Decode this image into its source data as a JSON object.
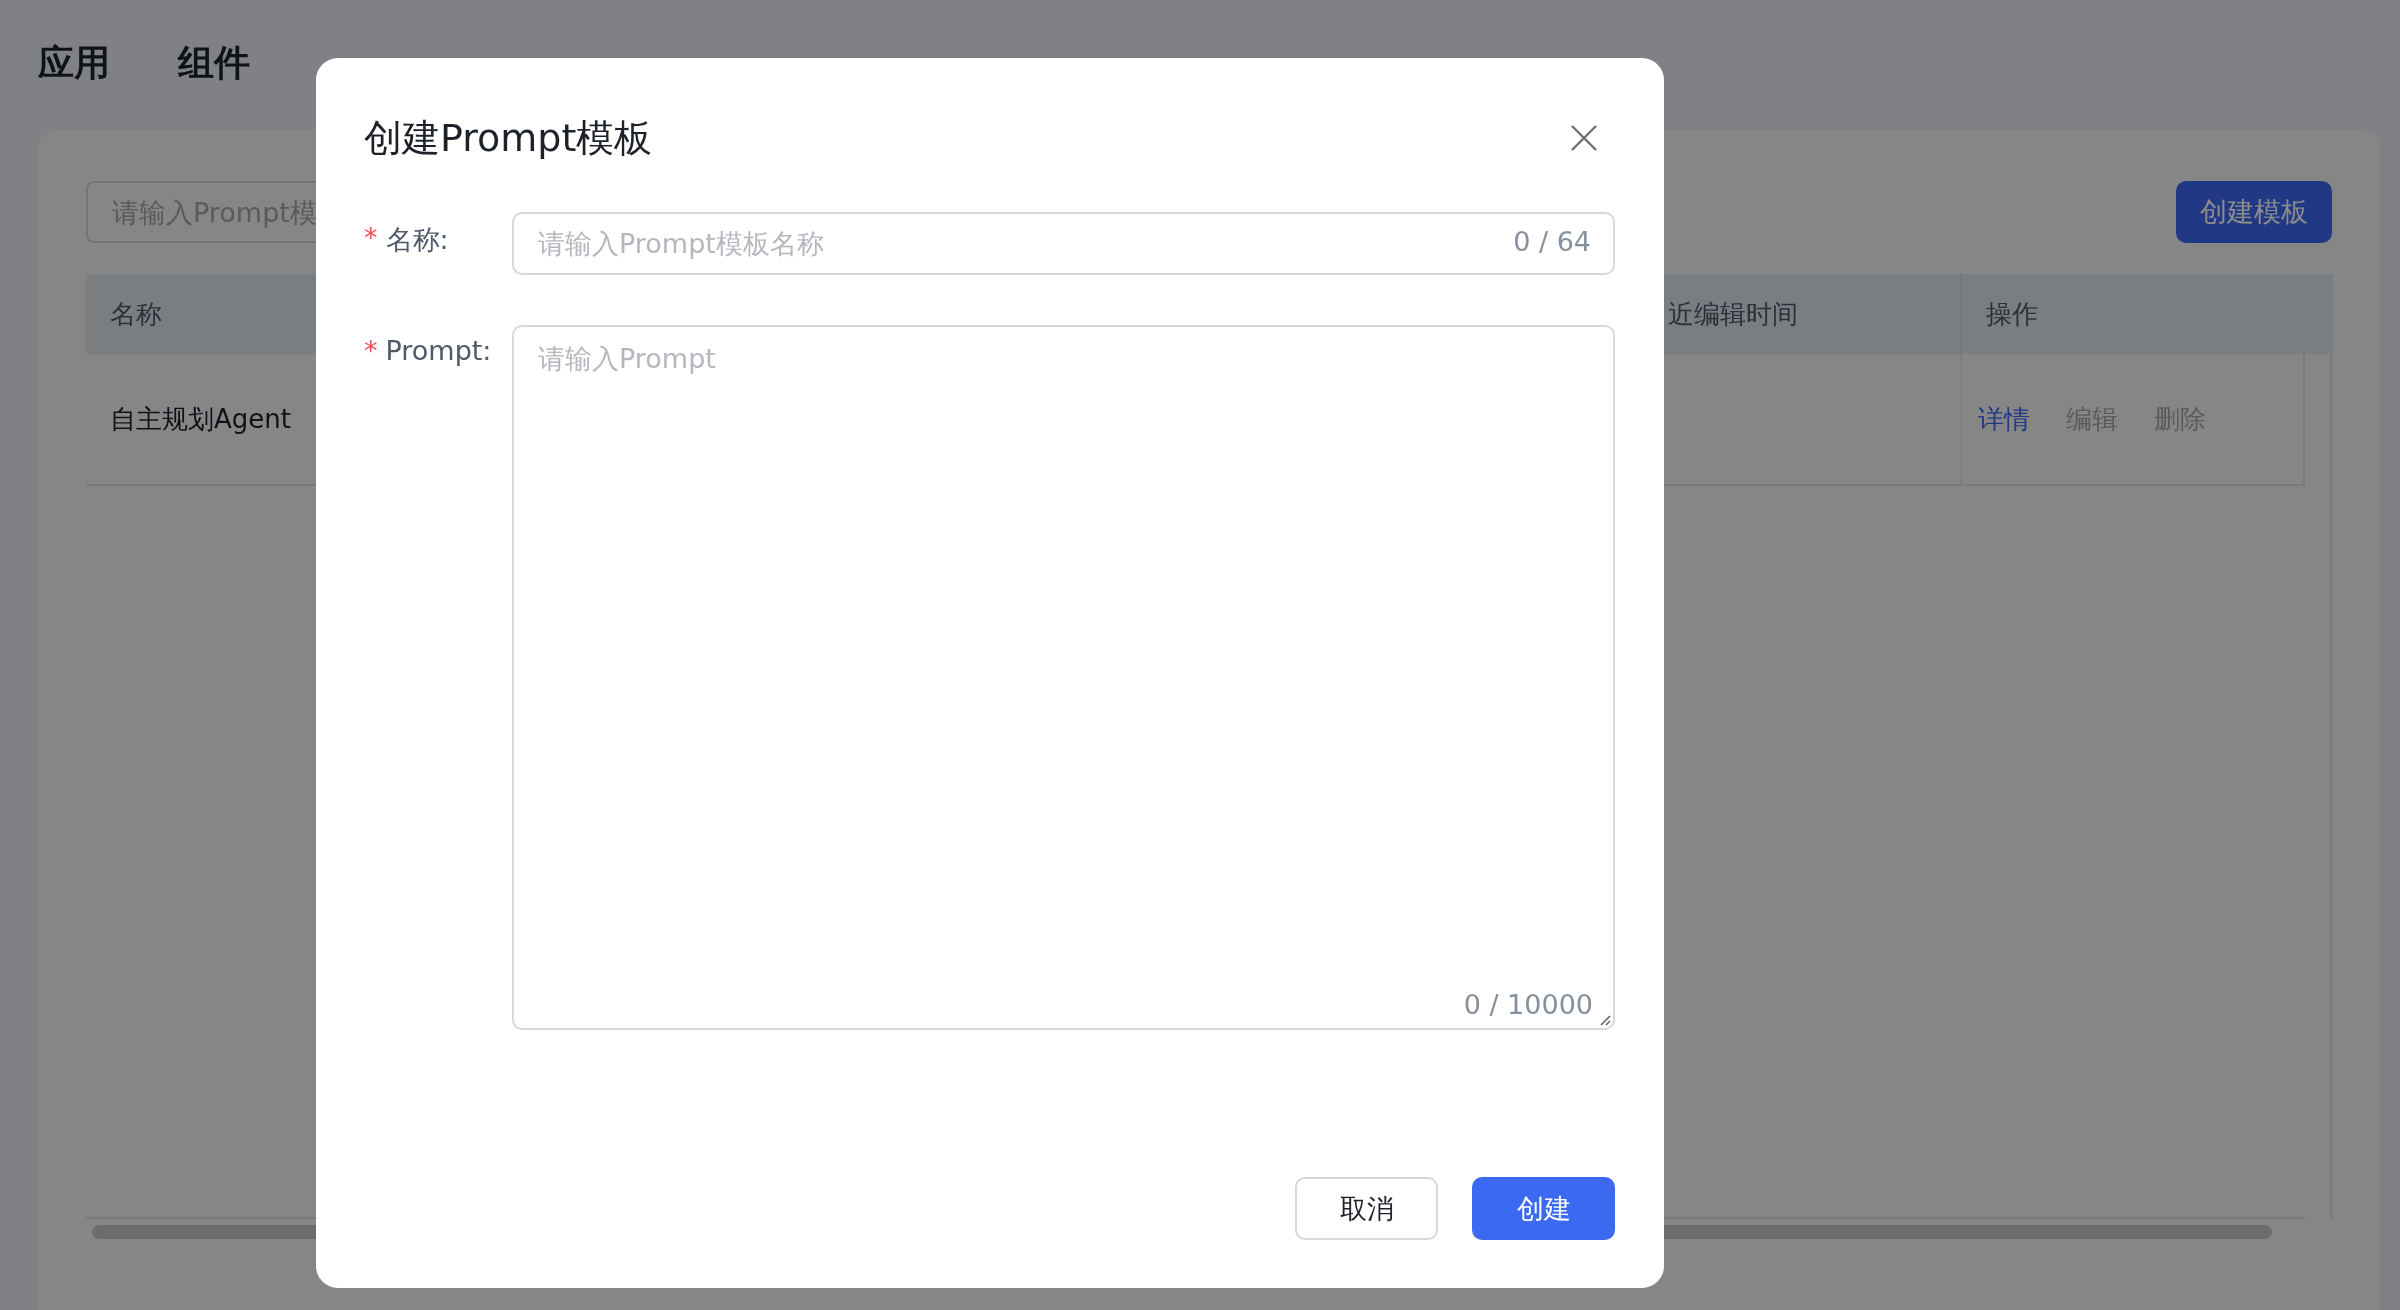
{
  "nav_tabs": [
    {
      "label": "应用",
      "selected": false
    },
    {
      "label": "组件",
      "selected": false
    }
  ],
  "search": {
    "placeholder": "请输入Prompt模"
  },
  "create_button": "创建模板",
  "table": {
    "columns": [
      "名称",
      "近编辑时间",
      "操作"
    ],
    "rows": [
      {
        "name": "自主规划Agent",
        "actions": [
          {
            "label": "详情",
            "primary": true
          },
          {
            "label": "编辑",
            "primary": false
          },
          {
            "label": "删除",
            "primary": false
          }
        ]
      }
    ]
  },
  "dialog": {
    "title": "创建Prompt模板",
    "fields": [
      {
        "kind": "input",
        "marker": "*",
        "label": "名称:",
        "placeholder": "请输入Prompt模板名称",
        "counter": "0 / 64"
      },
      {
        "kind": "textarea",
        "marker": "*",
        "label": "Prompt:",
        "placeholder": "请输入Prompt",
        "counter": "0 / 10000"
      }
    ],
    "buttons": [
      {
        "label": "取消",
        "primary": false
      },
      {
        "label": "创建",
        "primary": true
      }
    ]
  }
}
